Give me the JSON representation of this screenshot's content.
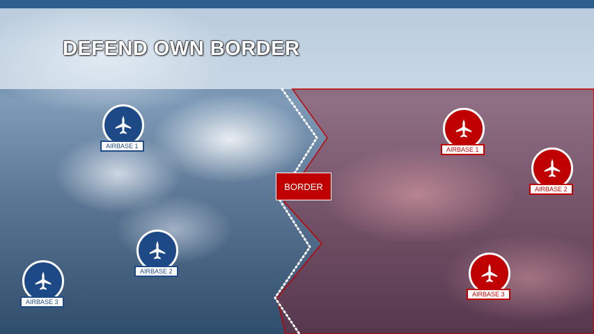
{
  "slide": {
    "title": "DEFEND OWN BORDER",
    "border_label": "BORDER"
  },
  "colors": {
    "own_forces": "#1d4a86",
    "enemy_forces": "#c00000",
    "enemy_zone": "#c00000"
  },
  "own_bases": [
    {
      "label": "AIRBASE 1",
      "icon": "fighter-jet-icon"
    },
    {
      "label": "AIRBASE 2",
      "icon": "fighter-jet-icon"
    },
    {
      "label": "AIRBASE 3",
      "icon": "fighter-jet-icon"
    }
  ],
  "enemy_bases": [
    {
      "label": "AIRBASE 1",
      "icon": "fighter-jet-icon"
    },
    {
      "label": "AIRBASE 2",
      "icon": "fighter-jet-icon"
    },
    {
      "label": "AIRBASE 3",
      "icon": "fighter-jet-icon"
    }
  ]
}
